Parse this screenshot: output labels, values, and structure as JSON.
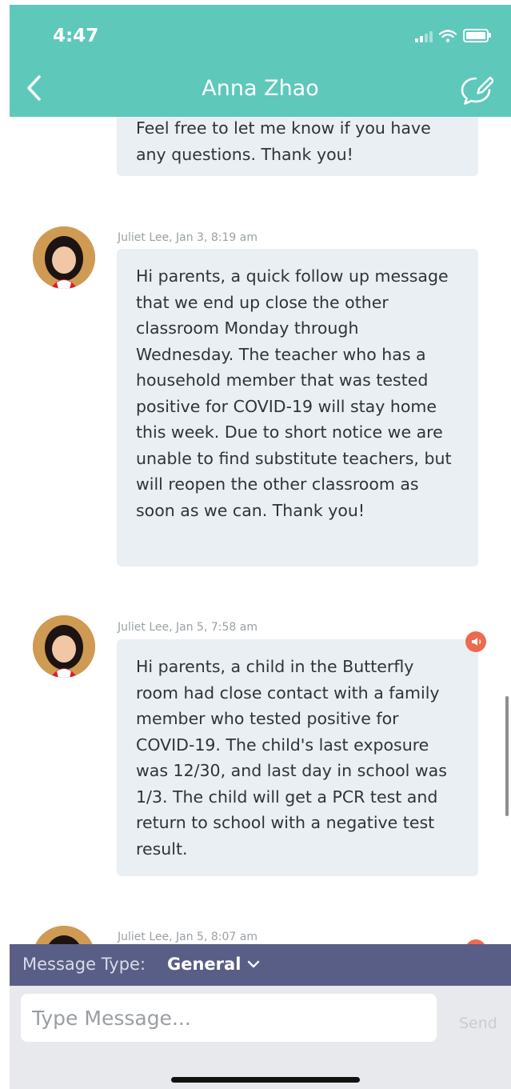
{
  "status": {
    "time": "4:47"
  },
  "header": {
    "title": "Anna Zhao"
  },
  "messages": [
    {
      "text": "Feel free to let me know if you have any questions. Thank you!"
    },
    {
      "sender": "Juliet Lee, Jan 3, 8:19 am",
      "text": "Hi parents, a quick follow up message that we end up close the other classroom Monday through Wednesday. The teacher who has a household member that was tested positive for COVID-19 will stay home this week. Due to short notice we are unable to find substitute teachers, but will reopen the other classroom as soon as we can. Thank you!"
    },
    {
      "sender": "Juliet Lee, Jan 5, 7:58 am",
      "text": "Hi parents, a child in the Butterfly room had close contact with a family member who tested positive for COVID-19. The child's last exposure was 12/30, and last day in school was 1/3. The child will get a PCR test and return to school with a negative test result."
    },
    {
      "sender": "Juliet Lee, Jan 5, 8:07 am"
    }
  ],
  "composer": {
    "message_type_label": "Message Type:",
    "message_type_value": "General",
    "placeholder": "Type Message...",
    "send_label": "Send"
  },
  "colors": {
    "header": "#5ec8bb",
    "bubble": "#e9eff2",
    "composer_bar": "#595e86",
    "alert": "#ec6b4f"
  },
  "icons": [
    "back-chevron-icon",
    "compose-icon",
    "signal-icon",
    "wifi-icon",
    "battery-icon",
    "announcement-icon",
    "chevron-down-icon"
  ]
}
